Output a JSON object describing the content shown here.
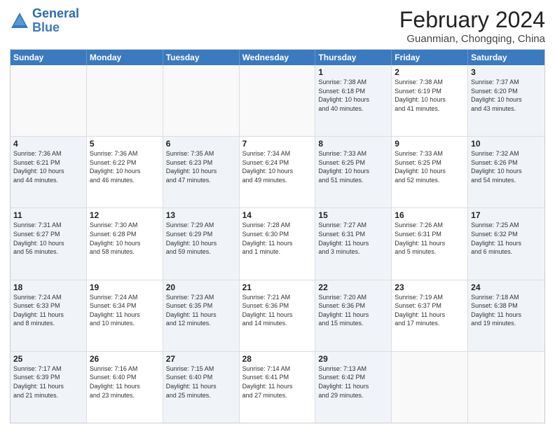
{
  "logo": {
    "line1": "General",
    "line2": "Blue"
  },
  "title": "February 2024",
  "subtitle": "Guanmian, Chongqing, China",
  "header_days": [
    "Sunday",
    "Monday",
    "Tuesday",
    "Wednesday",
    "Thursday",
    "Friday",
    "Saturday"
  ],
  "weeks": [
    [
      {
        "day": "",
        "info": "",
        "empty": true
      },
      {
        "day": "",
        "info": "",
        "empty": true
      },
      {
        "day": "",
        "info": "",
        "empty": true
      },
      {
        "day": "",
        "info": "",
        "empty": true
      },
      {
        "day": "1",
        "info": "Sunrise: 7:38 AM\nSunset: 6:18 PM\nDaylight: 10 hours\nand 40 minutes."
      },
      {
        "day": "2",
        "info": "Sunrise: 7:38 AM\nSunset: 6:19 PM\nDaylight: 10 hours\nand 41 minutes."
      },
      {
        "day": "3",
        "info": "Sunrise: 7:37 AM\nSunset: 6:20 PM\nDaylight: 10 hours\nand 43 minutes."
      }
    ],
    [
      {
        "day": "4",
        "info": "Sunrise: 7:36 AM\nSunset: 6:21 PM\nDaylight: 10 hours\nand 44 minutes."
      },
      {
        "day": "5",
        "info": "Sunrise: 7:36 AM\nSunset: 6:22 PM\nDaylight: 10 hours\nand 46 minutes."
      },
      {
        "day": "6",
        "info": "Sunrise: 7:35 AM\nSunset: 6:23 PM\nDaylight: 10 hours\nand 47 minutes."
      },
      {
        "day": "7",
        "info": "Sunrise: 7:34 AM\nSunset: 6:24 PM\nDaylight: 10 hours\nand 49 minutes."
      },
      {
        "day": "8",
        "info": "Sunrise: 7:33 AM\nSunset: 6:25 PM\nDaylight: 10 hours\nand 51 minutes."
      },
      {
        "day": "9",
        "info": "Sunrise: 7:33 AM\nSunset: 6:25 PM\nDaylight: 10 hours\nand 52 minutes."
      },
      {
        "day": "10",
        "info": "Sunrise: 7:32 AM\nSunset: 6:26 PM\nDaylight: 10 hours\nand 54 minutes."
      }
    ],
    [
      {
        "day": "11",
        "info": "Sunrise: 7:31 AM\nSunset: 6:27 PM\nDaylight: 10 hours\nand 56 minutes."
      },
      {
        "day": "12",
        "info": "Sunrise: 7:30 AM\nSunset: 6:28 PM\nDaylight: 10 hours\nand 58 minutes."
      },
      {
        "day": "13",
        "info": "Sunrise: 7:29 AM\nSunset: 6:29 PM\nDaylight: 10 hours\nand 59 minutes."
      },
      {
        "day": "14",
        "info": "Sunrise: 7:28 AM\nSunset: 6:30 PM\nDaylight: 11 hours\nand 1 minute."
      },
      {
        "day": "15",
        "info": "Sunrise: 7:27 AM\nSunset: 6:31 PM\nDaylight: 11 hours\nand 3 minutes."
      },
      {
        "day": "16",
        "info": "Sunrise: 7:26 AM\nSunset: 6:31 PM\nDaylight: 11 hours\nand 5 minutes."
      },
      {
        "day": "17",
        "info": "Sunrise: 7:25 AM\nSunset: 6:32 PM\nDaylight: 11 hours\nand 6 minutes."
      }
    ],
    [
      {
        "day": "18",
        "info": "Sunrise: 7:24 AM\nSunset: 6:33 PM\nDaylight: 11 hours\nand 8 minutes."
      },
      {
        "day": "19",
        "info": "Sunrise: 7:24 AM\nSunset: 6:34 PM\nDaylight: 11 hours\nand 10 minutes."
      },
      {
        "day": "20",
        "info": "Sunrise: 7:23 AM\nSunset: 6:35 PM\nDaylight: 11 hours\nand 12 minutes."
      },
      {
        "day": "21",
        "info": "Sunrise: 7:21 AM\nSunset: 6:36 PM\nDaylight: 11 hours\nand 14 minutes."
      },
      {
        "day": "22",
        "info": "Sunrise: 7:20 AM\nSunset: 6:36 PM\nDaylight: 11 hours\nand 15 minutes."
      },
      {
        "day": "23",
        "info": "Sunrise: 7:19 AM\nSunset: 6:37 PM\nDaylight: 11 hours\nand 17 minutes."
      },
      {
        "day": "24",
        "info": "Sunrise: 7:18 AM\nSunset: 6:38 PM\nDaylight: 11 hours\nand 19 minutes."
      }
    ],
    [
      {
        "day": "25",
        "info": "Sunrise: 7:17 AM\nSunset: 6:39 PM\nDaylight: 11 hours\nand 21 minutes."
      },
      {
        "day": "26",
        "info": "Sunrise: 7:16 AM\nSunset: 6:40 PM\nDaylight: 11 hours\nand 23 minutes."
      },
      {
        "day": "27",
        "info": "Sunrise: 7:15 AM\nSunset: 6:40 PM\nDaylight: 11 hours\nand 25 minutes."
      },
      {
        "day": "28",
        "info": "Sunrise: 7:14 AM\nSunset: 6:41 PM\nDaylight: 11 hours\nand 27 minutes."
      },
      {
        "day": "29",
        "info": "Sunrise: 7:13 AM\nSunset: 6:42 PM\nDaylight: 11 hours\nand 29 minutes."
      },
      {
        "day": "",
        "info": "",
        "empty": true
      },
      {
        "day": "",
        "info": "",
        "empty": true
      }
    ]
  ]
}
